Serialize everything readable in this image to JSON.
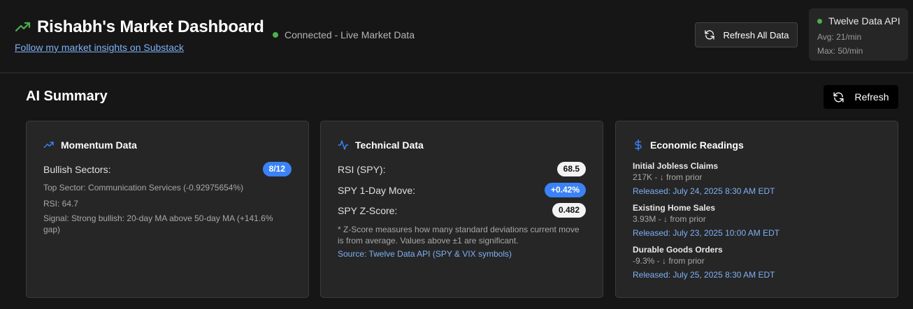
{
  "header": {
    "title": "Rishabh's Market Dashboard",
    "status": "Connected - Live Market Data",
    "substack_link": "Follow my market insights on Substack",
    "refresh_all_label": "Refresh All Data",
    "api": {
      "name": "Twelve Data API",
      "avg": "Avg: 21/min",
      "max": "Max: 50/min"
    }
  },
  "summary": {
    "title": "AI Summary",
    "refresh_label": "Refresh"
  },
  "momentum": {
    "title": "Momentum Data",
    "bullish_label": "Bullish Sectors:",
    "bullish_value": "8/12",
    "top_sector": "Top Sector: Communication Services (-0.92975654%)",
    "rsi": "RSI: 64.7",
    "signal": "Signal: Strong bullish: 20-day MA above 50-day MA (+141.6% gap)"
  },
  "technical": {
    "title": "Technical Data",
    "rows": [
      {
        "label": "RSI (SPY):",
        "value": "68.5"
      },
      {
        "label": "SPY 1-Day Move:",
        "value": "+0.42%"
      },
      {
        "label": "SPY Z-Score:",
        "value": "0.482"
      }
    ],
    "note": "* Z-Score measures how many standard deviations current move is from average. Values above ±1 are significant.",
    "source": "Source: Twelve Data API (SPY & VIX symbols)"
  },
  "economic": {
    "title": "Economic Readings",
    "items": [
      {
        "name": "Initial Jobless Claims",
        "value": "217K - ↓ from prior",
        "released": "Released: July 24, 2025 8:30 AM EDT"
      },
      {
        "name": "Existing Home Sales",
        "value": "3.93M - ↓ from prior",
        "released": "Released: July 23, 2025 10:00 AM EDT"
      },
      {
        "name": "Durable Goods Orders",
        "value": "-9.3% - ↓ from prior",
        "released": "Released: July 25, 2025 8:30 AM EDT"
      }
    ]
  },
  "colors": {
    "accent_blue": "#3b82f6",
    "link_blue": "#7fb0f5",
    "status_green": "#4caf50",
    "trend_green": "#4caf50"
  },
  "icons": {
    "title_icon": "trending-up-icon",
    "refresh_icon": "refresh-icon",
    "momentum_icon": "trending-up-icon",
    "technical_icon": "activity-icon",
    "economic_icon": "dollar-icon"
  }
}
